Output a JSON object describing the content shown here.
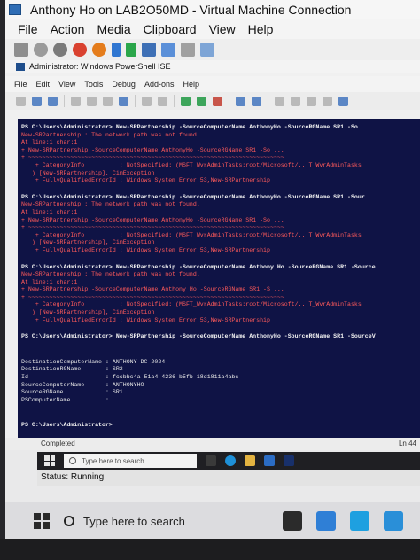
{
  "vm": {
    "title": "Anthony Ho on LAB2O50MD - Virtual Machine Connection",
    "menu": [
      "File",
      "Action",
      "Media",
      "Clipboard",
      "View",
      "Help"
    ],
    "status": "Status: Running"
  },
  "ise": {
    "title": "Administrator: Windows PowerShell ISE",
    "menu": [
      "File",
      "Edit",
      "View",
      "Tools",
      "Debug",
      "Add-ons",
      "Help"
    ],
    "status_left": "Completed",
    "status_right": "Ln 44"
  },
  "console": {
    "lines": [
      {
        "t": "PS C:\\Users\\Administrator> New-SRPartnership -SourceComputerName AnthonyHo -SourceRGName SR1 -So",
        "c": "cmd"
      },
      {
        "t": "New-SRPartnership : The network path was not found.",
        "c": "err"
      },
      {
        "t": "At line:1 char:1",
        "c": "err"
      },
      {
        "t": "+ New-SRPartnership -SourceComputerName AnthonyHo -SourceRGName SR1 -So ...",
        "c": "err"
      },
      {
        "t": "+ ~~~~~~~~~~~~~~~~~~~~~~~~~~~~~~~~~~~~~~~~~~~~~~~~~~~~~~~~~~~~~~~~~~~~~~~~~",
        "c": "err"
      },
      {
        "t": "    + CategoryInfo          : NotSpecified: (MSFT_WvrAdminTasks:root/Microsoft/...T_WvrAdminTasks",
        "c": "err"
      },
      {
        "t": "   ) [New-SRPartnership], CimException",
        "c": "err"
      },
      {
        "t": "    + FullyQualifiedErrorId : Windows System Error 53,New-SRPartnership",
        "c": "err"
      },
      {
        "t": "",
        "c": "gap"
      },
      {
        "t": "PS C:\\Users\\Administrator> New-SRPartnership -SourceComputerName AnthonyHo -SourceRGName SR1 -Sour",
        "c": "cmd"
      },
      {
        "t": "New-SRPartnership : The network path was not found.",
        "c": "err"
      },
      {
        "t": "At line:1 char:1",
        "c": "err"
      },
      {
        "t": "+ New-SRPartnership -SourceComputerName AnthonyHo -SourceRGName SR1 -So ...",
        "c": "err"
      },
      {
        "t": "+ ~~~~~~~~~~~~~~~~~~~~~~~~~~~~~~~~~~~~~~~~~~~~~~~~~~~~~~~~~~~~~~~~~~~~~~~~~",
        "c": "err"
      },
      {
        "t": "    + CategoryInfo          : NotSpecified: (MSFT_WvrAdminTasks:root/Microsoft/...T_WvrAdminTasks",
        "c": "err"
      },
      {
        "t": "   ) [New-SRPartnership], CimException",
        "c": "err"
      },
      {
        "t": "    + FullyQualifiedErrorId : Windows System Error 53,New-SRPartnership",
        "c": "err"
      },
      {
        "t": "",
        "c": "gap"
      },
      {
        "t": "PS C:\\Users\\Administrator> New-SRPartnership -SourceComputerName Anthony Ho -SourceRGName SR1 -Source",
        "c": "cmd"
      },
      {
        "t": "New-SRPartnership : The network path was not found.",
        "c": "err"
      },
      {
        "t": "At line:1 char:1",
        "c": "err"
      },
      {
        "t": "+ New-SRPartnership -SourceComputerName Anthony Ho -SourceRGName SR1 -S ...",
        "c": "err"
      },
      {
        "t": "+ ~~~~~~~~~~~~~~~~~~~~~~~~~~~~~~~~~~~~~~~~~~~~~~~~~~~~~~~~~~~~~~~~~~~~~~~~~",
        "c": "err"
      },
      {
        "t": "    + CategoryInfo          : NotSpecified: (MSFT_WvrAdminTasks:root/Microsoft/...T_WvrAdminTasks",
        "c": "err"
      },
      {
        "t": "   ) [New-SRPartnership], CimException",
        "c": "err"
      },
      {
        "t": "    + FullyQualifiedErrorId : Windows System Error 53,New-SRPartnership",
        "c": "err"
      },
      {
        "t": "",
        "c": "gap"
      },
      {
        "t": "PS C:\\Users\\Administrator> New-SRPartnership -SourceComputerName AnthonyHo -SourceRGName SR1 -SourceV",
        "c": "cmd"
      },
      {
        "t": "",
        "c": "gap"
      },
      {
        "t": "",
        "c": "gap"
      },
      {
        "t": "DestinationComputerName : ANTHONY-DC-2024",
        "c": "val"
      },
      {
        "t": "DestinationRGName       : SR2",
        "c": "val"
      },
      {
        "t": "Id                      : fccbbc4a-51a4-4236-b5fb-18d1811a4abc",
        "c": "val"
      },
      {
        "t": "SourceComputerName      : ANTHONYHO",
        "c": "val"
      },
      {
        "t": "SourceRGName            : SR1",
        "c": "val"
      },
      {
        "t": "PSComputerName          :",
        "c": "val"
      },
      {
        "t": "",
        "c": "gap"
      },
      {
        "t": "",
        "c": "gap"
      },
      {
        "t": "PS C:\\Users\\Administrator>",
        "c": "cmd"
      }
    ]
  },
  "guest_taskbar": {
    "search_placeholder": "Type here to search"
  },
  "host_taskbar": {
    "search_placeholder": "Type here to search"
  }
}
